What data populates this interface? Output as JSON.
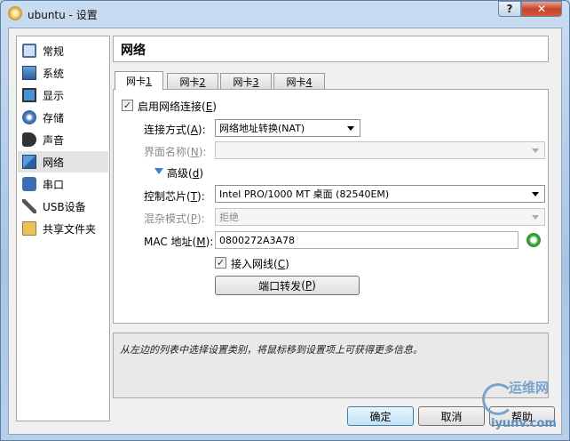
{
  "window": {
    "title": "ubuntu - 设置",
    "help_label": "?",
    "close_label": "✕"
  },
  "sidebar": {
    "items": [
      {
        "label": "常规",
        "icon": "general-icon"
      },
      {
        "label": "系统",
        "icon": "system-icon"
      },
      {
        "label": "显示",
        "icon": "display-icon"
      },
      {
        "label": "存储",
        "icon": "storage-icon"
      },
      {
        "label": "声音",
        "icon": "audio-icon"
      },
      {
        "label": "网络",
        "icon": "network-icon",
        "selected": true
      },
      {
        "label": "串口",
        "icon": "serial-port-icon"
      },
      {
        "label": "USB设备",
        "icon": "usb-icon"
      },
      {
        "label": "共享文件夹",
        "icon": "shared-folder-icon"
      }
    ]
  },
  "page": {
    "title": "网络"
  },
  "tabs": [
    {
      "prefix": "网卡 ",
      "key": "1",
      "active": true
    },
    {
      "prefix": "网卡 ",
      "key": "2"
    },
    {
      "prefix": "网卡 ",
      "key": "3"
    },
    {
      "prefix": "网卡 ",
      "key": "4"
    }
  ],
  "adapter": {
    "enable_label": "启用网络连接",
    "enable_key": "E",
    "enable_checked": true,
    "attached_label": "连接方式",
    "attached_key": "A",
    "attached_value": "网络地址转换(NAT)",
    "name_label": "界面名称",
    "name_key": "N",
    "name_value": "",
    "advanced_label": "高级",
    "advanced_key": "d",
    "adapter_type_label": "控制芯片",
    "adapter_type_key": "T",
    "adapter_type_value": "Intel PRO/1000 MT 桌面 (82540EM)",
    "promisc_label": "混杂模式",
    "promisc_key": "P",
    "promisc_value": "拒绝",
    "mac_label": "MAC 地址",
    "mac_key": "M",
    "mac_value": "0800272A3A78",
    "cable_label": "接入网线",
    "cable_key": "C",
    "cable_checked": true,
    "port_forward_label": "端口转发",
    "port_forward_key": "P"
  },
  "info": {
    "text": "从左边的列表中选择设置类别，将鼠标移到设置项上可获得更多信息。"
  },
  "buttons": {
    "ok": "确定",
    "cancel": "取消",
    "help": "帮助"
  },
  "watermark": {
    "line1": "运维网",
    "line2": "iyunv.com"
  }
}
